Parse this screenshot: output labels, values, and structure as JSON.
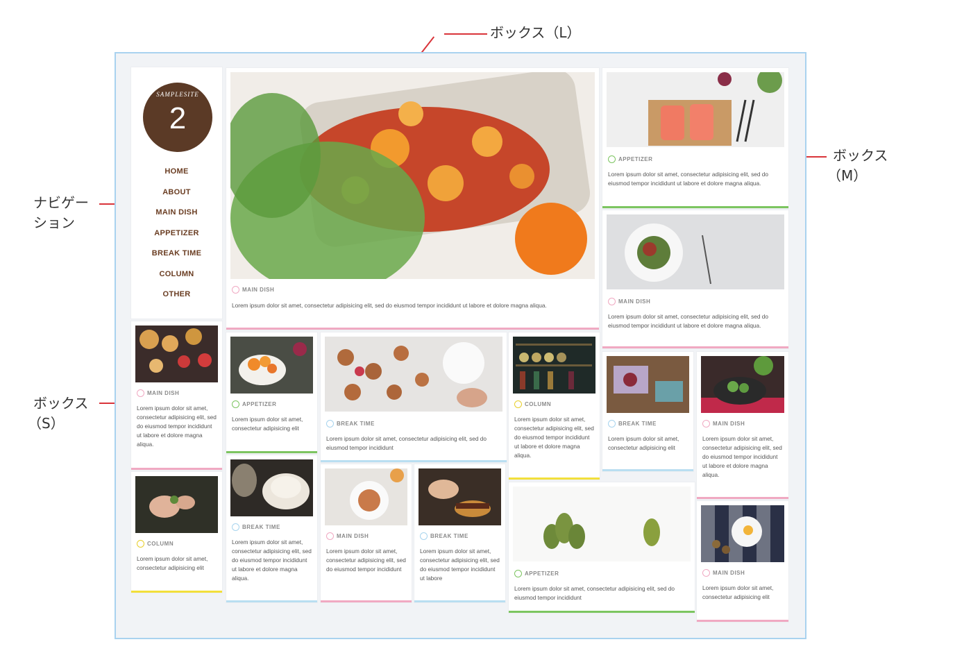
{
  "annotations": {
    "box_l": "ボックス（L）",
    "box_m_line1": "ボックス",
    "box_m_line2": "（M）",
    "nav_line1": "ナビゲー",
    "nav_line2": "ション",
    "box_s_line1": "ボックス",
    "box_s_line2": "（S）"
  },
  "logo": {
    "text": "SAMPLESITE",
    "number": "2"
  },
  "nav": {
    "items": [
      "HOME",
      "ABOUT",
      "MAIN DISH",
      "APPETIZER",
      "BREAK TIME",
      "COLUMN",
      "OTHER"
    ]
  },
  "cards": {
    "large": {
      "category": "MAIN DISH",
      "text": "Lorem ipsum dolor sit amet, consectetur adipisicing elit, sed do eiusmod tempor incididunt ut labore et dolore magna aliqua."
    },
    "m1": {
      "category": "APPETIZER",
      "text": "Lorem ipsum dolor sit amet, consectetur adipisicing elit, sed do eiusmod tempor incididunt ut labore et dolore magna aliqua."
    },
    "m2": {
      "category": "MAIN DISH",
      "text": "Lorem ipsum dolor sit amet, consectetur adipisicing elit, sed do eiusmod tempor incididunt ut labore et dolore magna aliqua."
    },
    "s_maindish": {
      "category": "MAIN DISH",
      "text": "Lorem ipsum dolor sit amet, consectetur adipisicing elit, sed do eiusmod tempor incididunt ut labore et dolore magna aliqua."
    },
    "s_column": {
      "category": "COLUMN",
      "text": "Lorem ipsum dolor sit amet, consectetur adipisicing elit"
    },
    "appetizer_s": {
      "category": "APPETIZER",
      "text": "Lorem ipsum dolor sit amet, consectetur adipisicing elit"
    },
    "breaktime_wide": {
      "category": "BREAK TIME",
      "text": "Lorem ipsum dolor sit amet, consectetur adipisicing elit, sed do eiusmod tempor incididunt"
    },
    "column_tall": {
      "category": "COLUMN",
      "text": "Lorem ipsum dolor sit amet, consectetur adipisicing elit, sed do eiusmod tempor incididunt ut labore et dolore magna aliqua."
    },
    "breaktime_r": {
      "category": "BREAK TIME",
      "text": "Lorem ipsum dolor sit amet, consectetur adipisicing elit"
    },
    "maindish_r": {
      "category": "MAIN DISH",
      "text": "Lorem ipsum dolor sit amet, consectetur adipisicing elit, sed do eiusmod tempor incididunt ut labore et dolore magna aliqua."
    },
    "breaktime_cup": {
      "category": "BREAK TIME",
      "text": "Lorem ipsum dolor sit amet, consectetur adipisicing elit, sed do eiusmod tempor incididunt ut labore et dolore magna aliqua."
    },
    "maindish_plate": {
      "category": "MAIN DISH",
      "text": "Lorem ipsum dolor sit amet, consectetur adipisicing elit, sed do eiusmod tempor incididunt"
    },
    "breaktime_burger": {
      "category": "BREAK TIME",
      "text": "Lorem ipsum dolor sit amet, consectetur adipisicing elit, sed do eiusmod tempor incididunt ut labore"
    },
    "appetizer_pears": {
      "category": "APPETIZER",
      "text": "Lorem ipsum dolor sit amet, consectetur adipisicing elit, sed do eiusmod tempor incididunt"
    },
    "maindish_egg": {
      "category": "MAIN DISH",
      "text": "Lorem ipsum dolor sit amet, consectetur adipisicing elit"
    }
  },
  "colors": {
    "accent_brown": "#5b3a26",
    "frame_blue": "#a9d2ef",
    "annotation_red": "#d9343a",
    "pink": "#f0a9c2",
    "green": "#7cc560",
    "yellow": "#f2df3b",
    "blue": "#b9def1"
  }
}
